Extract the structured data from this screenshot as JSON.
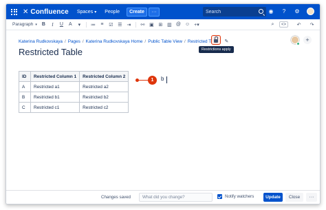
{
  "nav": {
    "app_name": "Confluence",
    "spaces_label": "Spaces",
    "people_label": "People",
    "create_label": "Create",
    "more_label": "···",
    "search_placeholder": "Search",
    "icons": [
      "apps-grid-icon",
      "confluence-logo-icon",
      "search-icon",
      "notifications-icon",
      "help-icon",
      "settings-icon",
      "avatar"
    ]
  },
  "toolbar": {
    "paragraph_label": "Paragraph",
    "bold": "B",
    "italic": "I",
    "underline": "U",
    "text_color": "A",
    "code_label": "<>",
    "icons": [
      "bullet-list-icon",
      "numbered-list-icon",
      "task-list-icon",
      "align-icon",
      "link-icon",
      "image-icon",
      "table-icon",
      "layout-icon",
      "insert-icon",
      "code-icon",
      "undo-icon",
      "redo-icon"
    ]
  },
  "breadcrumb": {
    "items": [
      "Katerina Rudkovskaya",
      "Pages",
      "Katerina Rudkovskaya Home",
      "Public Table View",
      "Restricted Table"
    ],
    "separator": "/"
  },
  "restrictions": {
    "tooltip": "Restrictions apply",
    "icon": "lock-icon"
  },
  "page": {
    "title": "Restricted Table"
  },
  "table": {
    "headers": [
      "ID",
      "Restricted Column 1",
      "Restricted Column 2"
    ],
    "rows": [
      [
        "A",
        "Restricted a1",
        "Restricted a2"
      ],
      [
        "B",
        "Restricted b1",
        "Restricted b2"
      ],
      [
        "C",
        "Restricted c1",
        "Restricted c2"
      ]
    ]
  },
  "annotation": {
    "badge": "1",
    "text": "b",
    "color": "#de350b"
  },
  "bottom": {
    "saved_text": "Changes saved",
    "comment_placeholder": "What did you change?",
    "notify_label": "Notify watchers",
    "update_label": "Update",
    "close_label": "Close",
    "more_label": "···"
  },
  "colors": {
    "brand": "#0052cc",
    "link": "#0052cc",
    "text": "#172b4d",
    "alert": "#de350b"
  }
}
